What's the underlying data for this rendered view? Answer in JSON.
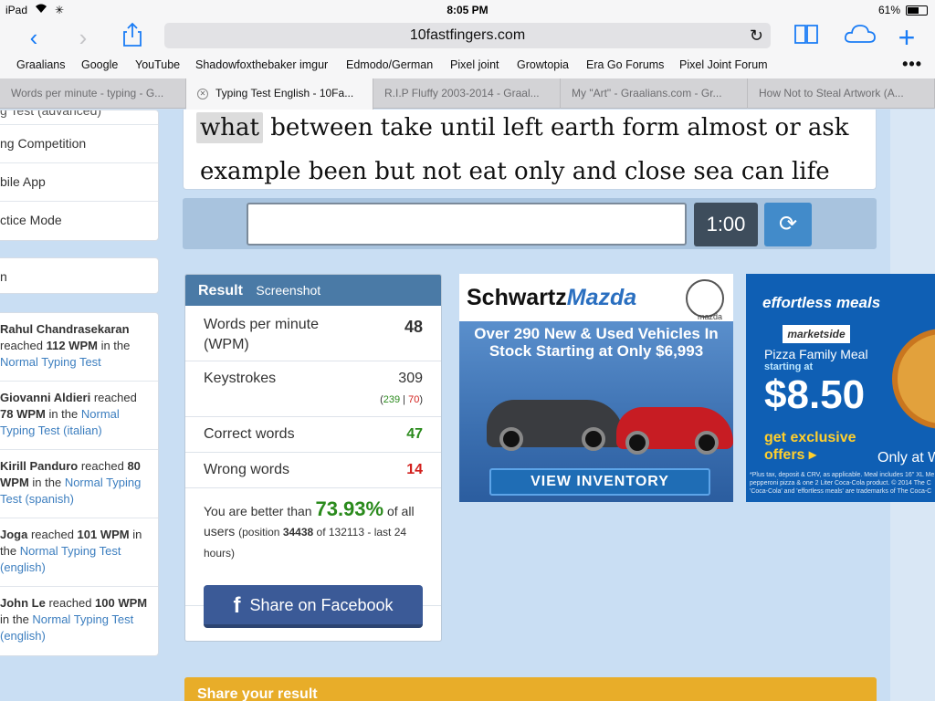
{
  "status": {
    "device": "iPad",
    "time": "8:05 PM",
    "battery": "61%",
    "battery_level": 0.61
  },
  "toolbar": {
    "url": "10fastfingers.com"
  },
  "bookmarks": [
    "Graalians",
    "Google",
    "YouTube",
    "Shadowfoxthebaker imgur",
    "Edmodo/German",
    "Pixel joint",
    "Growtopia",
    "Era Go Forums",
    "Pixel Joint Forum"
  ],
  "tabs": [
    {
      "label": "Words per minute - typing - G..."
    },
    {
      "label": "Typing Test English - 10Fa..."
    },
    {
      "label": "R.I.P Fluffy 2003-2014 - Graal..."
    },
    {
      "label": "My \"Art\" - Graalians.com - Gr..."
    },
    {
      "label": "How Not to Steal Artwork (A..."
    }
  ],
  "sidebar": {
    "menu": [
      "g Test (advanced)",
      "ng Competition",
      "bile App",
      "ctice Mode"
    ],
    "box2": "n",
    "activity": [
      {
        "name": "Rahul Chandrasekaran",
        "pre": " reached ",
        "wpm": "112 WPM",
        "mid": " in the ",
        "test": "Normal Typing Test",
        "tail": ""
      },
      {
        "name": "Giovanni Aldieri",
        "pre": " reached ",
        "wpm": "78 WPM",
        "mid": " in the ",
        "test": "Normal Typing Test (italian)",
        "tail": ""
      },
      {
        "name": "Kirill Panduro",
        "pre": " reached ",
        "wpm": "80 WPM",
        "mid": " in the ",
        "test": "Normal Typing Test (spanish)",
        "tail": ""
      },
      {
        "name": "Joga",
        "pre": " reached ",
        "wpm": "101 WPM",
        "mid": " in the ",
        "test": "Normal Typing Test (english)",
        "tail": ""
      },
      {
        "name": "John Le",
        "pre": " reached ",
        "wpm": "100 WPM",
        "mid": " in the ",
        "test": "Normal Typing Test (english)",
        "tail": ""
      }
    ]
  },
  "test": {
    "highlight_word": "what",
    "line1_rest": " between take until left earth form almost or ask",
    "line2": "example been but not eat only and close sea can life",
    "input_value": "",
    "timer": "1:00"
  },
  "result": {
    "tab_result": "Result",
    "tab_screenshot": "Screenshot",
    "wpm_label": "Words per minute (WPM)",
    "wpm_value": "48",
    "keystrokes_label": "Keystrokes",
    "keystrokes_value": "309",
    "keystrokes_correct": "239",
    "keystrokes_wrong": "70",
    "correct_label": "Correct words",
    "correct_value": "47",
    "wrong_label": "Wrong words",
    "wrong_value": "14",
    "better_prefix": "You are better than ",
    "better_pct": "73.93%",
    "better_suffix": " of all users ",
    "position_label": "(position ",
    "position_value": "34438",
    "position_tail": " of 132113 - last 24 hours)",
    "fb_icon": "f",
    "fb_label": "Share on Facebook"
  },
  "ads": {
    "ad1": {
      "brand1": "Schwartz",
      "brand2": "Mazda",
      "logo_text": "mazda",
      "headline": "Over 290 New & Used Vehicles In Stock Starting at Only $6,993",
      "cta": "VIEW INVENTORY"
    },
    "ad2": {
      "top": "effortless meals",
      "marketside": "marketside",
      "product": "Pizza Family Meal",
      "starting": "starting at",
      "price": "$8.50",
      "offer": "get exclusive offers ▸",
      "only": "Only at W",
      "fine": "*Plus tax, deposit & CRV, as applicable. Meal includes 16\" XL Me pepperoni pizza & one 2 Liter Coca-Cola product. © 2014 The C 'Coca-Cola' and 'effortless meals' are trademarks of The Coca-C"
    }
  },
  "share_bar": "Share your result",
  "colors": {
    "accent": "#1a7cf5",
    "result_header": "#4a7aa6",
    "green": "#2a8a1c",
    "red": "#d2201d",
    "facebook": "#3b5a97",
    "share_bar": "#e8ad29"
  }
}
